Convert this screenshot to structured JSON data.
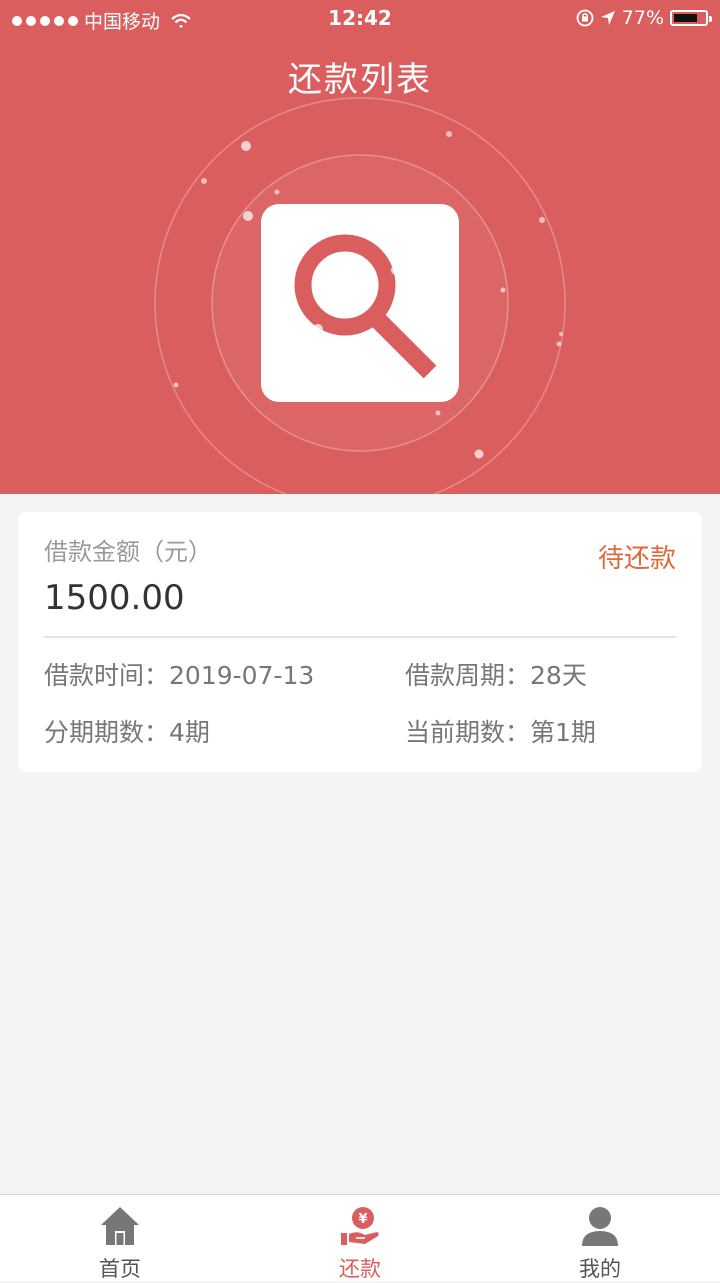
{
  "status_bar": {
    "carrier": "中国移动",
    "time": "12:42",
    "battery": "77%",
    "battery_level": 0.77
  },
  "header": {
    "title": "还款列表"
  },
  "loan_card": {
    "amount_label": "借款金额（元）",
    "amount": "1500.00",
    "status": "待还款",
    "loan_date_label": "借款时间：",
    "loan_date": "2019-07-13",
    "term_label": "借款周期：",
    "term": "28天",
    "installments_label": "分期期数：",
    "installments": "4期",
    "current_label": "当前期数：",
    "current": "第1期"
  },
  "tabbar": {
    "items": [
      {
        "label": "首页",
        "icon": "home-icon"
      },
      {
        "label": "还款",
        "icon": "repayment-icon",
        "active": true
      },
      {
        "label": "我的",
        "icon": "user-icon"
      }
    ]
  },
  "colors": {
    "brand": "#db5e5e",
    "status": "#e0683b",
    "background": "#f4f4f4"
  }
}
